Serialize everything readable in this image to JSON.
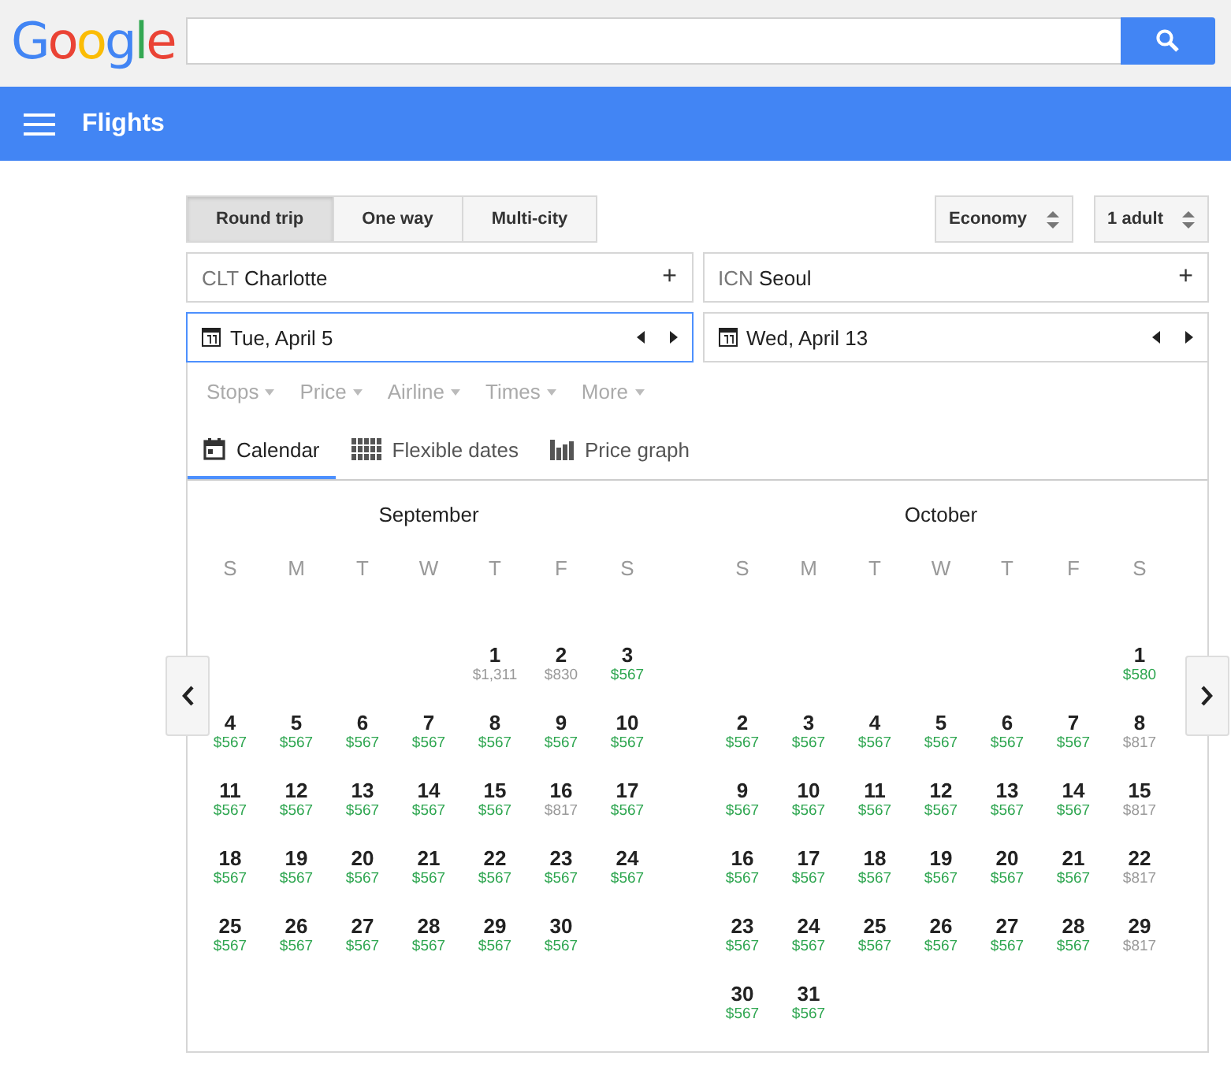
{
  "logo_letters": [
    {
      "text": "G",
      "color": "#4285f4"
    },
    {
      "text": "o",
      "color": "#ea4335"
    },
    {
      "text": "o",
      "color": "#fbbc05"
    },
    {
      "text": "g",
      "color": "#4285f4"
    },
    {
      "text": "l",
      "color": "#34a853"
    },
    {
      "text": "e",
      "color": "#ea4335"
    }
  ],
  "app_bar": {
    "title": "Flights"
  },
  "trip_types": [
    {
      "label": "Round trip",
      "selected": true
    },
    {
      "label": "One way",
      "selected": false
    },
    {
      "label": "Multi-city",
      "selected": false
    }
  ],
  "selects": [
    {
      "value": "Economy"
    },
    {
      "value": "1 adult"
    }
  ],
  "places": [
    {
      "code": "CLT",
      "city": "Charlotte",
      "symbol": "+"
    },
    {
      "code": "ICN",
      "city": "Seoul",
      "symbol": "+"
    }
  ],
  "dates": [
    {
      "value": "Tue, April 5",
      "selected": true
    },
    {
      "value": "Wed, April 13",
      "selected": false
    }
  ],
  "filters": [
    "Stops",
    "Price",
    "Airline",
    "Times",
    "More"
  ],
  "views": [
    {
      "label": "Calendar",
      "kind": "calendar",
      "selected": true
    },
    {
      "label": "Flexible dates",
      "kind": "grid",
      "selected": false
    },
    {
      "label": "Price graph",
      "kind": "bars",
      "selected": false
    }
  ],
  "months": [
    {
      "title": "September",
      "weekdays": [
        "S",
        "M",
        "T",
        "W",
        "T",
        "F",
        "S"
      ],
      "days": [
        {
          "kind": "blank"
        },
        {
          "kind": "blank"
        },
        {
          "kind": "blank"
        },
        {
          "kind": "blank"
        },
        {
          "kind": "day",
          "day": "1",
          "price": "$1,311",
          "low": false
        },
        {
          "kind": "day",
          "day": "2",
          "price": "$830",
          "low": false
        },
        {
          "kind": "day",
          "day": "3",
          "price": "$567",
          "low": true
        },
        {
          "kind": "day",
          "day": "4",
          "price": "$567",
          "low": true
        },
        {
          "kind": "day",
          "day": "5",
          "price": "$567",
          "low": true
        },
        {
          "kind": "day",
          "day": "6",
          "price": "$567",
          "low": true
        },
        {
          "kind": "day",
          "day": "7",
          "price": "$567",
          "low": true
        },
        {
          "kind": "day",
          "day": "8",
          "price": "$567",
          "low": true
        },
        {
          "kind": "day",
          "day": "9",
          "price": "$567",
          "low": true
        },
        {
          "kind": "day",
          "day": "10",
          "price": "$567",
          "low": true
        },
        {
          "kind": "day",
          "day": "11",
          "price": "$567",
          "low": true
        },
        {
          "kind": "day",
          "day": "12",
          "price": "$567",
          "low": true
        },
        {
          "kind": "day",
          "day": "13",
          "price": "$567",
          "low": true
        },
        {
          "kind": "day",
          "day": "14",
          "price": "$567",
          "low": true
        },
        {
          "kind": "day",
          "day": "15",
          "price": "$567",
          "low": true
        },
        {
          "kind": "day",
          "day": "16",
          "price": "$817",
          "low": false
        },
        {
          "kind": "day",
          "day": "17",
          "price": "$567",
          "low": true
        },
        {
          "kind": "day",
          "day": "18",
          "price": "$567",
          "low": true
        },
        {
          "kind": "day",
          "day": "19",
          "price": "$567",
          "low": true
        },
        {
          "kind": "day",
          "day": "20",
          "price": "$567",
          "low": true
        },
        {
          "kind": "day",
          "day": "21",
          "price": "$567",
          "low": true
        },
        {
          "kind": "day",
          "day": "22",
          "price": "$567",
          "low": true
        },
        {
          "kind": "day",
          "day": "23",
          "price": "$567",
          "low": true
        },
        {
          "kind": "day",
          "day": "24",
          "price": "$567",
          "low": true
        },
        {
          "kind": "day",
          "day": "25",
          "price": "$567",
          "low": true
        },
        {
          "kind": "day",
          "day": "26",
          "price": "$567",
          "low": true
        },
        {
          "kind": "day",
          "day": "27",
          "price": "$567",
          "low": true
        },
        {
          "kind": "day",
          "day": "28",
          "price": "$567",
          "low": true
        },
        {
          "kind": "day",
          "day": "29",
          "price": "$567",
          "low": true
        },
        {
          "kind": "day",
          "day": "30",
          "price": "$567",
          "low": true
        }
      ]
    },
    {
      "title": "October",
      "weekdays": [
        "S",
        "M",
        "T",
        "W",
        "T",
        "F",
        "S"
      ],
      "days": [
        {
          "kind": "blank"
        },
        {
          "kind": "blank"
        },
        {
          "kind": "blank"
        },
        {
          "kind": "blank"
        },
        {
          "kind": "blank"
        },
        {
          "kind": "blank"
        },
        {
          "kind": "day",
          "day": "1",
          "price": "$580",
          "low": true
        },
        {
          "kind": "day",
          "day": "2",
          "price": "$567",
          "low": true
        },
        {
          "kind": "day",
          "day": "3",
          "price": "$567",
          "low": true
        },
        {
          "kind": "day",
          "day": "4",
          "price": "$567",
          "low": true
        },
        {
          "kind": "day",
          "day": "5",
          "price": "$567",
          "low": true
        },
        {
          "kind": "day",
          "day": "6",
          "price": "$567",
          "low": true
        },
        {
          "kind": "day",
          "day": "7",
          "price": "$567",
          "low": true
        },
        {
          "kind": "day",
          "day": "8",
          "price": "$817",
          "low": false
        },
        {
          "kind": "day",
          "day": "9",
          "price": "$567",
          "low": true
        },
        {
          "kind": "day",
          "day": "10",
          "price": "$567",
          "low": true
        },
        {
          "kind": "day",
          "day": "11",
          "price": "$567",
          "low": true
        },
        {
          "kind": "day",
          "day": "12",
          "price": "$567",
          "low": true
        },
        {
          "kind": "day",
          "day": "13",
          "price": "$567",
          "low": true
        },
        {
          "kind": "day",
          "day": "14",
          "price": "$567",
          "low": true
        },
        {
          "kind": "day",
          "day": "15",
          "price": "$817",
          "low": false
        },
        {
          "kind": "day",
          "day": "16",
          "price": "$567",
          "low": true
        },
        {
          "kind": "day",
          "day": "17",
          "price": "$567",
          "low": true
        },
        {
          "kind": "day",
          "day": "18",
          "price": "$567",
          "low": true
        },
        {
          "kind": "day",
          "day": "19",
          "price": "$567",
          "low": true
        },
        {
          "kind": "day",
          "day": "20",
          "price": "$567",
          "low": true
        },
        {
          "kind": "day",
          "day": "21",
          "price": "$567",
          "low": true
        },
        {
          "kind": "day",
          "day": "22",
          "price": "$817",
          "low": false
        },
        {
          "kind": "day",
          "day": "23",
          "price": "$567",
          "low": true
        },
        {
          "kind": "day",
          "day": "24",
          "price": "$567",
          "low": true
        },
        {
          "kind": "day",
          "day": "25",
          "price": "$567",
          "low": true
        },
        {
          "kind": "day",
          "day": "26",
          "price": "$567",
          "low": true
        },
        {
          "kind": "day",
          "day": "27",
          "price": "$567",
          "low": true
        },
        {
          "kind": "day",
          "day": "28",
          "price": "$567",
          "low": true
        },
        {
          "kind": "day",
          "day": "29",
          "price": "$817",
          "low": false
        },
        {
          "kind": "day",
          "day": "30",
          "price": "$567",
          "low": true
        },
        {
          "kind": "day",
          "day": "31",
          "price": "$567",
          "low": true
        }
      ]
    }
  ]
}
